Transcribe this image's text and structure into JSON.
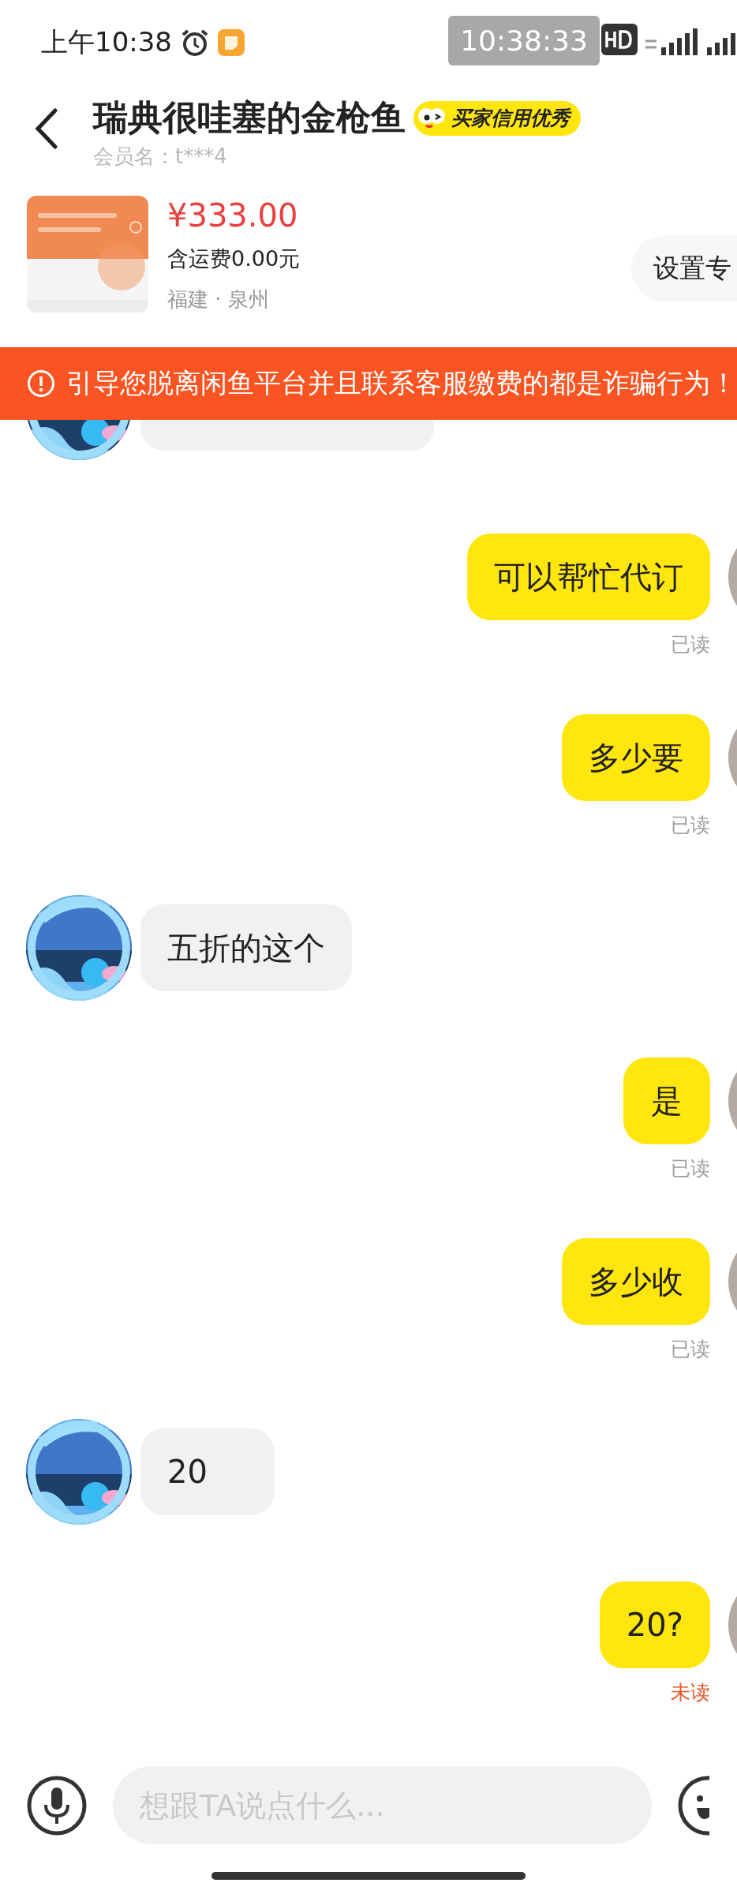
{
  "status_bar": {
    "time": "上午10:38",
    "clock_overlay": "10:38:33"
  },
  "header": {
    "title": "瑞典很哇塞的金枪鱼",
    "badge": "买家信用优秀",
    "member": "会员名：t***4"
  },
  "product": {
    "price": "¥333.00",
    "shipping": "含运费0.00元",
    "location": "福建 · 泉州",
    "action_button": "设置专"
  },
  "warning": "引导您脱离闲鱼平台并且联系客服缴费的都是诈骗行为！",
  "messages": [
    {
      "kind": "partial"
    },
    {
      "kind": "right",
      "text": "可以帮忙代订",
      "status": {
        "text": "已读",
        "kind": "read"
      }
    },
    {
      "kind": "right",
      "text": "多少要",
      "status": {
        "text": "已读",
        "kind": "read"
      }
    },
    {
      "kind": "left",
      "text": "五折的这个"
    },
    {
      "kind": "right",
      "text": "是",
      "status": {
        "text": "已读",
        "kind": "read"
      }
    },
    {
      "kind": "right",
      "text": "多少收",
      "status": {
        "text": "已读",
        "kind": "read"
      }
    },
    {
      "kind": "left",
      "text": "20"
    },
    {
      "kind": "right",
      "text": "20?",
      "status": {
        "text": "未读",
        "kind": "unread"
      }
    }
  ],
  "input": {
    "placeholder": "想跟TA说点什么..."
  }
}
